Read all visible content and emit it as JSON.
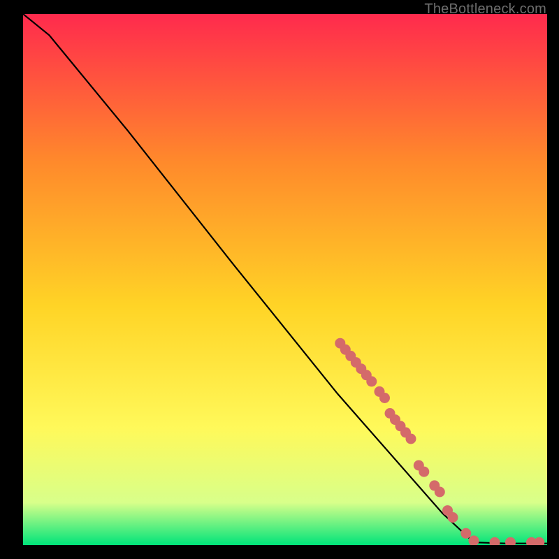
{
  "attribution": "TheBottleneck.com",
  "colors": {
    "background": "#000000",
    "gradient_top": "#ff2a4d",
    "gradient_mid_upper": "#ff8a2b",
    "gradient_mid": "#ffd426",
    "gradient_mid_lower": "#fff95a",
    "gradient_lower": "#d8ff8a",
    "gradient_bottom": "#00e47a",
    "curve": "#000000",
    "dot_fill": "#d46a6a",
    "dot_stroke": "#b84f4f"
  },
  "chart_data": {
    "type": "line",
    "title": "",
    "xlabel": "",
    "ylabel": "",
    "ylim": [
      0,
      100
    ],
    "xlim": [
      0,
      100
    ],
    "curve": [
      {
        "x": 0,
        "y": 100
      },
      {
        "x": 5,
        "y": 96
      },
      {
        "x": 10,
        "y": 90
      },
      {
        "x": 20,
        "y": 78
      },
      {
        "x": 40,
        "y": 53
      },
      {
        "x": 60,
        "y": 28.5
      },
      {
        "x": 80,
        "y": 6
      },
      {
        "x": 86,
        "y": 0.5
      },
      {
        "x": 92,
        "y": 0.3
      },
      {
        "x": 100,
        "y": 0.3
      }
    ],
    "dots": [
      {
        "x": 60.5,
        "y": 38.0
      },
      {
        "x": 61.5,
        "y": 36.8
      },
      {
        "x": 62.5,
        "y": 35.6
      },
      {
        "x": 63.5,
        "y": 34.4
      },
      {
        "x": 64.5,
        "y": 33.2
      },
      {
        "x": 65.5,
        "y": 32.0
      },
      {
        "x": 66.5,
        "y": 30.8
      },
      {
        "x": 68.0,
        "y": 28.9
      },
      {
        "x": 69.0,
        "y": 27.7
      },
      {
        "x": 70.0,
        "y": 24.8
      },
      {
        "x": 71.0,
        "y": 23.6
      },
      {
        "x": 72.0,
        "y": 22.4
      },
      {
        "x": 73.0,
        "y": 21.2
      },
      {
        "x": 74.0,
        "y": 20.0
      },
      {
        "x": 75.5,
        "y": 15.0
      },
      {
        "x": 76.5,
        "y": 13.8
      },
      {
        "x": 78.5,
        "y": 11.2
      },
      {
        "x": 79.5,
        "y": 10.0
      },
      {
        "x": 81.0,
        "y": 6.5
      },
      {
        "x": 82.0,
        "y": 5.2
      },
      {
        "x": 84.5,
        "y": 2.2
      },
      {
        "x": 86.0,
        "y": 0.8
      },
      {
        "x": 90.0,
        "y": 0.5
      },
      {
        "x": 93.0,
        "y": 0.5
      },
      {
        "x": 97.0,
        "y": 0.5
      },
      {
        "x": 98.5,
        "y": 0.5
      }
    ]
  }
}
